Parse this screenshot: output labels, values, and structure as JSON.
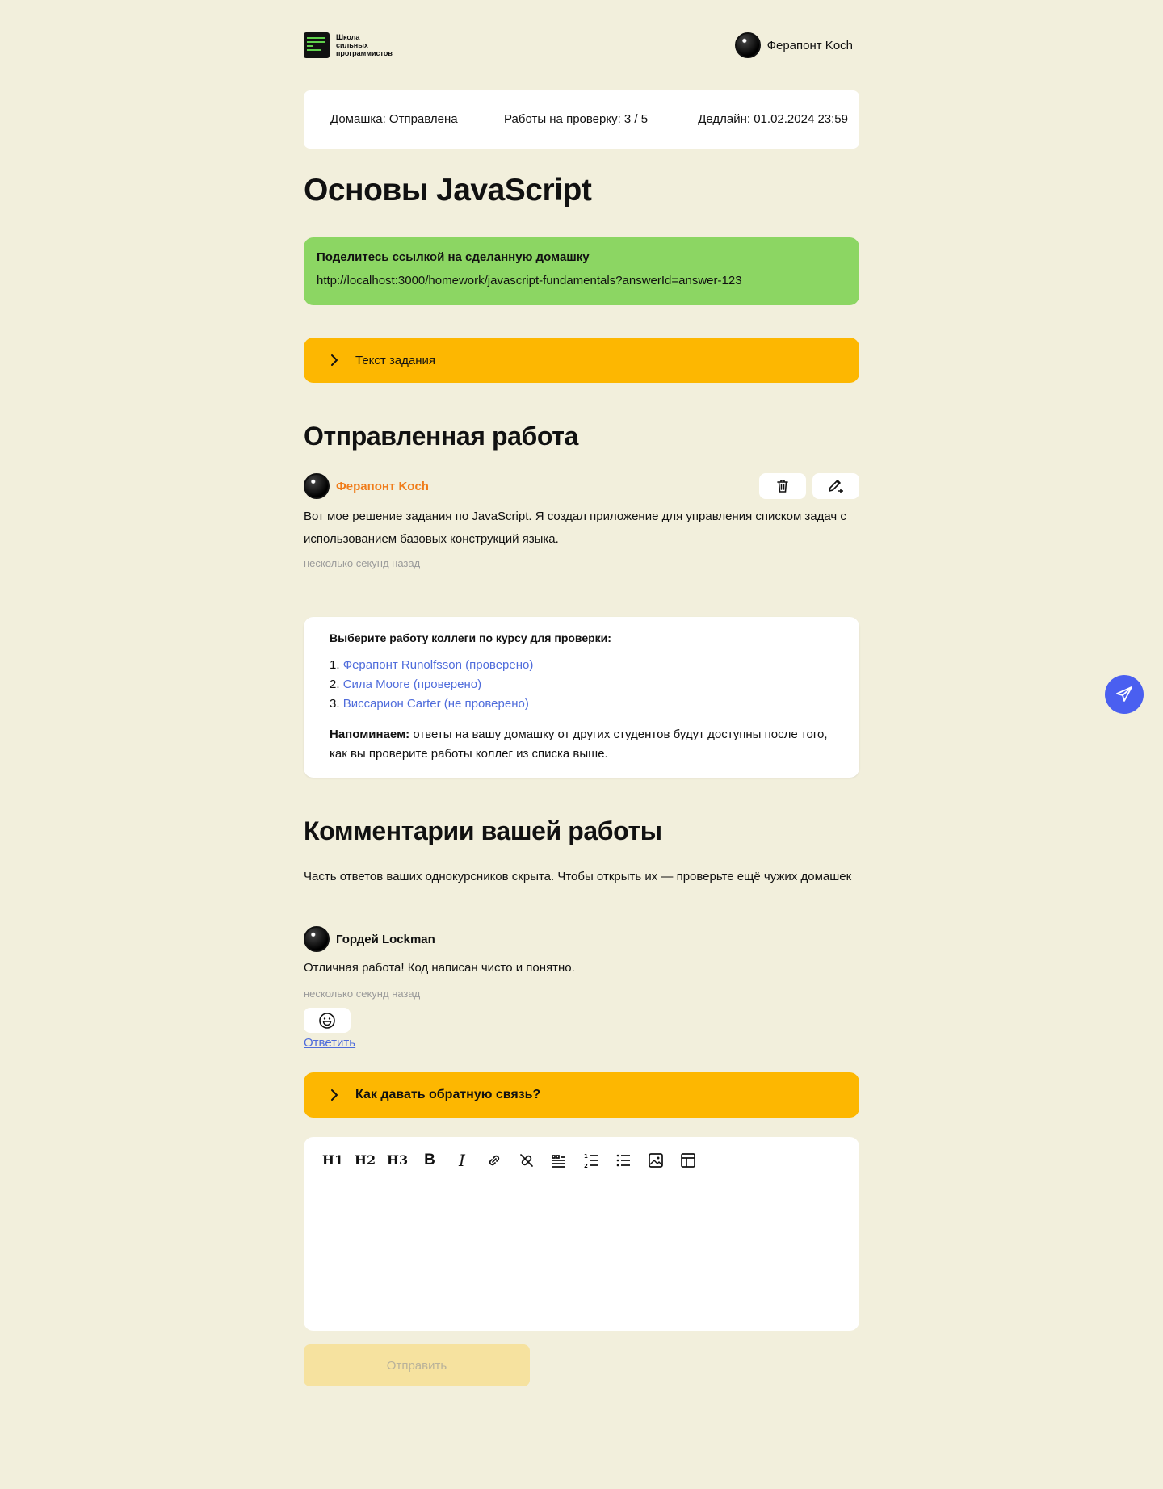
{
  "header": {
    "logo_lines": [
      "Школа",
      "сильных",
      "программистов"
    ],
    "user_name": "Ферапонт Koch"
  },
  "status": {
    "homework": "Домашка: Отправлена",
    "reviews": "Работы на проверку: 3 / 5",
    "deadline": "Дедлайн: 01.02.2024 23:59"
  },
  "page_title": "Основы JavaScript",
  "share": {
    "title": "Поделитесь ссылкой на сделанную домашку",
    "link": "http://localhost:3000/homework/javascript-fundamentals?answerId=answer-123"
  },
  "task_accordion_label": "Текст задания",
  "submitted": {
    "heading": "Отправленная работа",
    "author": "Ферапонт Koch",
    "text": "Вот мое решение задания по JavaScript. Я создал приложение для управления списком задач с использованием базовых конструкций языка.",
    "time": "несколько секунд назад"
  },
  "review": {
    "title": "Выберите работу коллеги по курсу для проверки:",
    "items": [
      {
        "num": "1.",
        "label": "Ферапонт Runolfsson (проверено)"
      },
      {
        "num": "2.",
        "label": "Сила Moore (проверено)"
      },
      {
        "num": "3.",
        "label": "Виссарион Carter (не проверено)"
      }
    ],
    "reminder_bold": "Напоминаем:",
    "reminder_text": " ответы на вашу домашку от других студентов будут доступны после того, как вы проверите работы коллег из списка выше."
  },
  "comments": {
    "heading": "Комментарии вашей работы",
    "hidden_note": "Часть ответов ваших однокурсников скрыта. Чтобы открыть их — проверьте ещё чужих домашек",
    "items": [
      {
        "author": "Гордей Lockman",
        "text": "Отличная работа! Код написан чисто и понятно.",
        "time": "несколько секунд назад",
        "reply_label": "Ответить"
      }
    ]
  },
  "feedback_accordion_label": "Как давать обратную связь?",
  "editor": {
    "toolbar": [
      {
        "name": "heading1",
        "label": "H1"
      },
      {
        "name": "heading2",
        "label": "H2"
      },
      {
        "name": "heading3",
        "label": "H3"
      },
      {
        "name": "bold",
        "label": "B"
      },
      {
        "name": "italic",
        "label": "I"
      }
    ]
  },
  "submit_label": "Отправить",
  "colors": {
    "background": "#f2efdc",
    "accent_yellow": "#fdb701",
    "share_green": "#8cd663",
    "author_orange": "#f07c1a",
    "link_blue": "#4f6cdb",
    "fab_blue": "#4a5ff0"
  }
}
